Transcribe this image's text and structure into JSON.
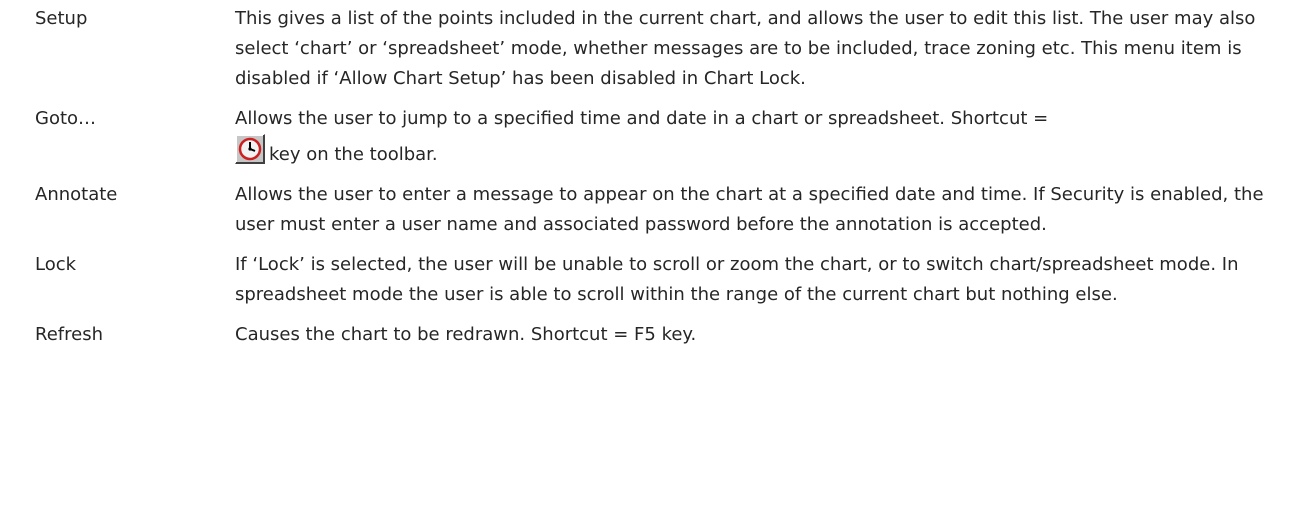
{
  "definitions": [
    {
      "term": "Setup",
      "description": "This gives a list of the points included in the current chart, and allows the user to edit this list.  The user may also select ‘chart’ or ‘spreadsheet’ mode, whether  messages are to be included, trace zoning etc.  This menu item is disabled if ‘Allow Chart Setup’ has been disabled in Chart Lock."
    },
    {
      "term": "Goto…",
      "description": "Allows the user to jump to a specified time and date in a chart or spreadsheet.  Shortcut =",
      "description_after_icon": "key on the toolbar.",
      "icon": "clock-icon"
    },
    {
      "term": "Annotate",
      "description": "Allows the user to enter a message to appear on the chart at a specified date and time.  If Security is enabled, the user must enter a user name and associated password before the annotation is accepted."
    },
    {
      "term": "Lock",
      "description": "If ‘Lock’ is selected, the user will be unable to scroll or zoom the chart, or to switch chart/spreadsheet mode.  In spreadsheet mode the user is able to scroll within the range of the current chart but nothing else."
    },
    {
      "term": "Refresh",
      "description": "Causes the chart to be redrawn.  Shortcut = F5 key."
    }
  ]
}
